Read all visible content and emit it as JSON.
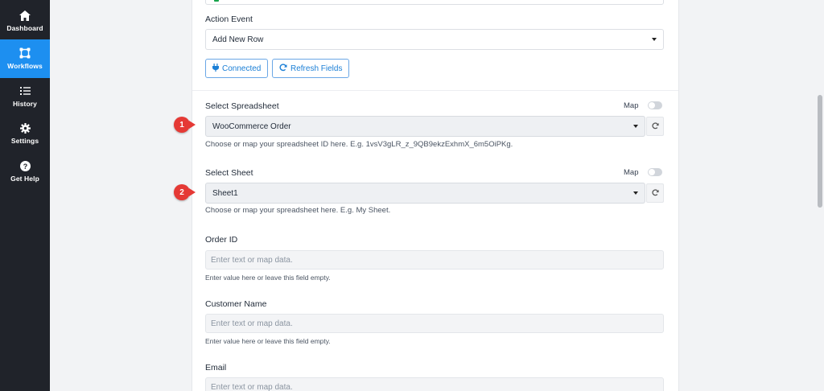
{
  "sidebar": {
    "items": [
      {
        "label": "Dashboard",
        "icon": "home-icon",
        "active": false
      },
      {
        "label": "Workflows",
        "icon": "workflows-icon",
        "active": true
      },
      {
        "label": "History",
        "icon": "history-icon",
        "active": false
      },
      {
        "label": "Settings",
        "icon": "gear-icon",
        "active": false
      },
      {
        "label": "Get Help",
        "icon": "question-icon",
        "active": false
      }
    ]
  },
  "action_event": {
    "label": "Action Event",
    "value": "Add New Row"
  },
  "buttons": {
    "connected": "Connected",
    "refresh_fields": "Refresh Fields"
  },
  "spreadsheet": {
    "label": "Select Spreadsheet",
    "map_label": "Map",
    "value": "WooCommerce Order",
    "help": "Choose or map your spreadsheet ID here. E.g. 1vsV3gLR_z_9QB9ekzExhmX_6m5OiPKg.",
    "badge": "1"
  },
  "sheet": {
    "label": "Select Sheet",
    "map_label": "Map",
    "value": "Sheet1",
    "help": "Choose or map your spreadsheet here. E.g. My Sheet.",
    "badge": "2"
  },
  "fields": [
    {
      "label": "Order ID",
      "placeholder": "Enter text or map data.",
      "help": "Enter value here or leave this field empty."
    },
    {
      "label": "Customer Name",
      "placeholder": "Enter text or map data.",
      "help": "Enter value here or leave this field empty."
    },
    {
      "label": "Email",
      "placeholder": "Enter text or map data."
    }
  ],
  "colors": {
    "sidebar_bg": "#20232a",
    "active_nav": "#1d8ff0",
    "badge": "#e53935",
    "button_text": "#1b7fd6"
  }
}
